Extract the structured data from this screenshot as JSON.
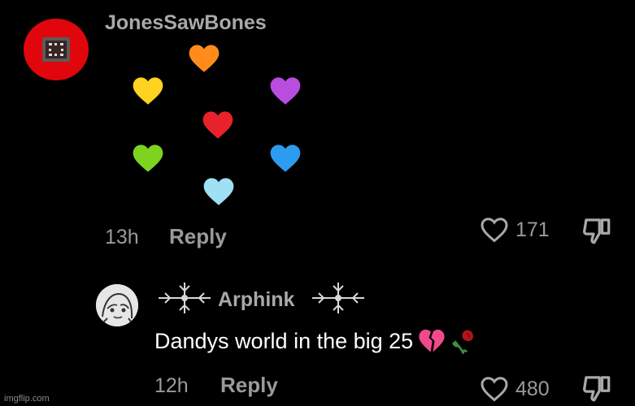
{
  "comment1": {
    "username": "JonesSawBones",
    "time": "13h",
    "reply_label": "Reply",
    "like_count": "171",
    "hearts": [
      {
        "name": "orange-heart-icon",
        "color": "#ff8c1a"
      },
      {
        "name": "yellow-heart-icon",
        "color": "#ffd21f"
      },
      {
        "name": "purple-heart-icon",
        "color": "#b84de0"
      },
      {
        "name": "red-heart-icon",
        "color": "#e8222a"
      },
      {
        "name": "green-heart-icon",
        "color": "#7ed321"
      },
      {
        "name": "blue-heart-icon",
        "color": "#2d9cf0"
      },
      {
        "name": "light-blue-heart-icon",
        "color": "#9fe0f5"
      }
    ]
  },
  "comment2": {
    "username": "Arphink",
    "text": "Dandys world in the big 25",
    "time": "12h",
    "reply_label": "Reply",
    "like_count": "480"
  },
  "watermark": "imgflip.com"
}
